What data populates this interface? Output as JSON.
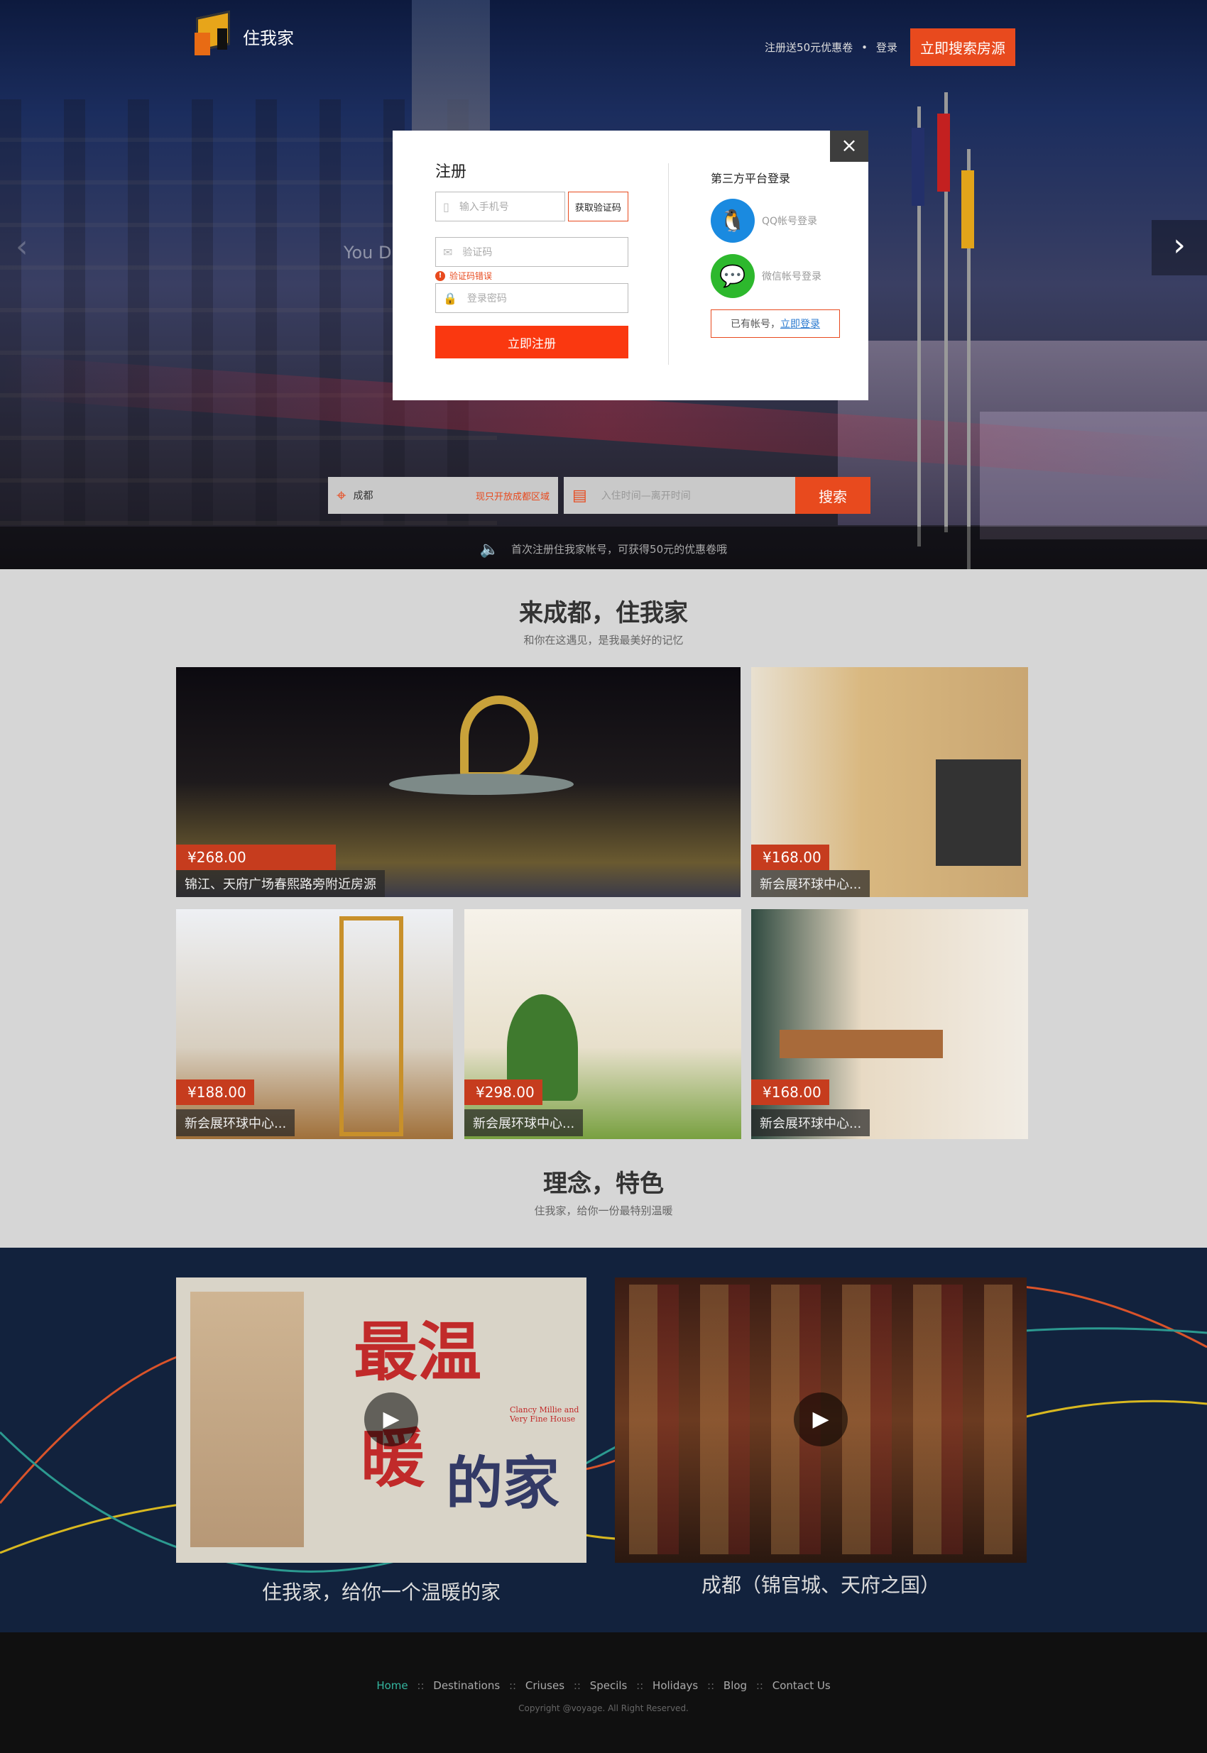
{
  "header": {
    "logo_text": "住我家",
    "coupon_link": "注册送50元优惠卷",
    "dot": "•",
    "login_link": "登录",
    "cta_button": "立即搜索房源"
  },
  "hero": {
    "caption": "You D",
    "prev_arrow": "‹",
    "next_arrow": "›",
    "notice": "首次注册住我家帐号，可获得50元的优惠卷哦"
  },
  "search": {
    "city": "成都",
    "city_note": "现只开放成都区域",
    "date_placeholder": "入住时间—离开时间",
    "button": "搜索"
  },
  "modal": {
    "close": "×",
    "title": "注册",
    "phone_placeholder": "输入手机号",
    "get_code_button": "获取验证码",
    "code_placeholder": "验证码",
    "error_text": "验证码错误",
    "password_placeholder": "登录密码",
    "submit_button": "立即注册",
    "third_party_title": "第三方平台登录",
    "qq_login": "QQ帐号登录",
    "wechat_login": "微信帐号登录",
    "have_account": "已有帐号，",
    "login_now": "立即登录"
  },
  "section1": {
    "title": "来成都，住我家",
    "subtitle": "和你在这遇见，是我最美好的记忆",
    "listings": [
      {
        "price": "¥268.00",
        "name": "锦江、天府广场春熙路旁附近房源"
      },
      {
        "price": "¥168.00",
        "name": "新会展环球中心..."
      },
      {
        "price": "¥188.00",
        "name": "新会展环球中心..."
      },
      {
        "price": "¥298.00",
        "name": "新会展环球中心..."
      },
      {
        "price": "¥168.00",
        "name": "新会展环球中心..."
      }
    ]
  },
  "section2": {
    "title": "理念，特色",
    "subtitle": "住我家，给你一份最特别温暖",
    "video1_caption": "住我家，给你一个温暖的家",
    "video1_art_1": "最温",
    "video1_art_2": "暖",
    "video1_art_3": "的家",
    "video1_art_en": "Clancy Millie and Very Fine House",
    "video2_caption": "成都（锦官城、天府之国）",
    "play": "▶"
  },
  "footer": {
    "nav": [
      "Home",
      "Destinations",
      "Criuses",
      "Specils",
      "Holidays",
      "Blog",
      "Contact Us"
    ],
    "sep": "::",
    "copyright": "Copyright @voyage. All Right Reserved."
  },
  "colors": {
    "accent": "#e84a1e",
    "submit": "#fa3810",
    "qq": "#1a8ae0",
    "wechat": "#2db82d",
    "footer_active": "#34b6a0"
  }
}
